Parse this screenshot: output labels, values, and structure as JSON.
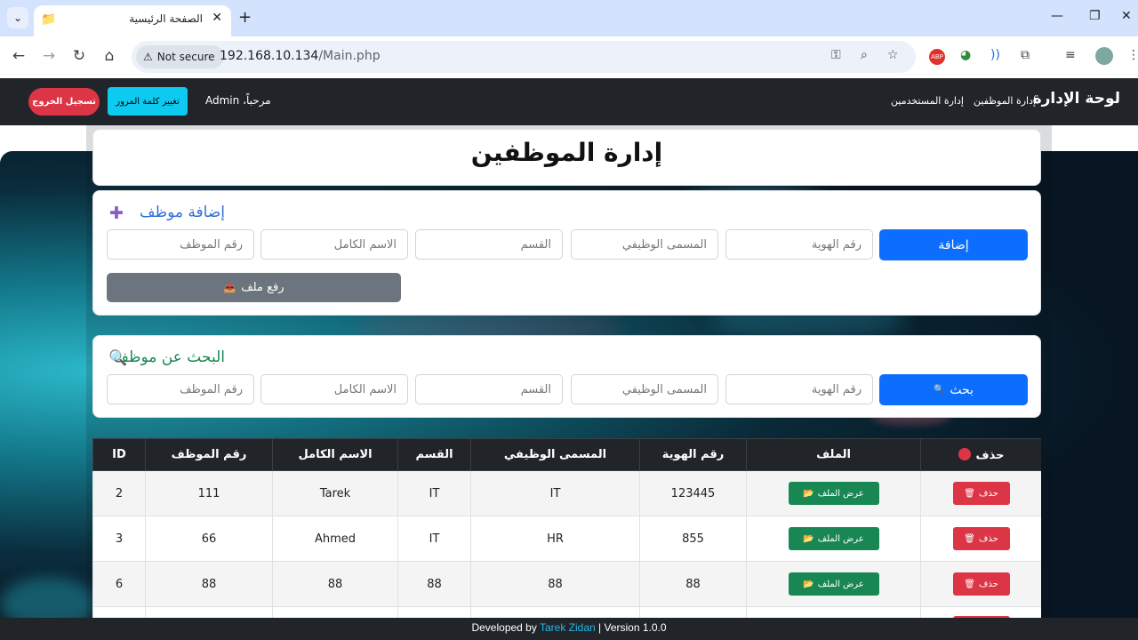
{
  "browser": {
    "tab_title": "الصفحة الرئيسية",
    "not_secure": "Not secure",
    "url_host": "192.168.10.134",
    "url_path": "/Main.php"
  },
  "nav": {
    "brand": "لوحة الإدارة",
    "link_employees": "إدارة الموظفين",
    "link_users": "إدارة المستخدمين",
    "welcome": "مرحباً، Admin",
    "change_password": "تغيير كلمة المرور",
    "logout": "تسجيل الخروج"
  },
  "main": {
    "title": "إدارة الموظفين"
  },
  "add_form": {
    "header": "إضافة موظف",
    "submit": "إضافة",
    "upload": "رفع ملف",
    "placeholders": {
      "id_number": "رقم الهوية",
      "job_title": "المسمى الوظيفي",
      "department": "القسم",
      "full_name": "الاسم الكامل",
      "employee_number": "رقم الموظف"
    }
  },
  "search_form": {
    "header": "البحث عن موظف",
    "submit": "بحث",
    "placeholders": {
      "id_number": "رقم الهوية",
      "job_title": "المسمى الوظيفي",
      "department": "القسم",
      "full_name": "الاسم الكامل",
      "employee_number": "رقم الموظف"
    }
  },
  "table": {
    "headers": {
      "delete": "حذف",
      "file": "الملف",
      "id_number": "رقم الهوية",
      "job_title": "المسمى الوظيفي",
      "department": "القسم",
      "full_name": "الاسم الكامل",
      "employee_number": "رقم الموظف",
      "id": "ID"
    },
    "delete_label": "حذف",
    "view_label": "عرض الملف",
    "rows": [
      {
        "id": "2",
        "employee_number": "111",
        "full_name": "Tarek",
        "department": "IT",
        "job_title": "IT",
        "id_number": "123445"
      },
      {
        "id": "3",
        "employee_number": "66",
        "full_name": "Ahmed",
        "department": "IT",
        "job_title": "HR",
        "id_number": "855"
      },
      {
        "id": "6",
        "employee_number": "88",
        "full_name": "88",
        "department": "88",
        "job_title": "88",
        "id_number": "88"
      }
    ]
  },
  "footer": {
    "prefix": "Developed by",
    "author": "Tarek Zidan",
    "version": "| Version 1.0.0"
  },
  "colors": {
    "navbar": "#212529",
    "primary": "#0d6efd",
    "danger": "#dc3545",
    "success": "#198754",
    "info": "#0dcaf0",
    "secondary": "#6c757d"
  }
}
